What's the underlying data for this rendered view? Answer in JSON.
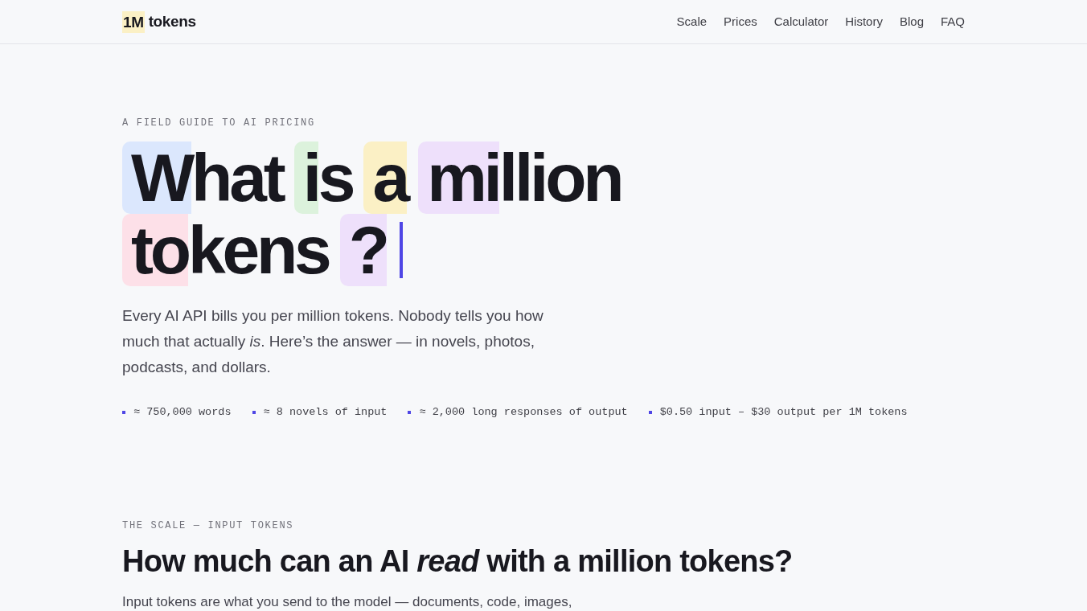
{
  "header": {
    "logo": {
      "mark": "1M",
      "text": "tokens"
    },
    "nav": [
      "Scale",
      "Prices",
      "Calculator",
      "History",
      "Blog",
      "FAQ"
    ]
  },
  "hero": {
    "eyebrow": "A FIELD GUIDE TO AI PRICING",
    "headline": [
      [
        {
          "highlighted": "W",
          "rest": "hat",
          "color": "#dbe7fd"
        },
        {
          "highlighted": "i",
          "rest": "s",
          "color": "#dcf2dc"
        },
        {
          "highlighted": "a",
          "color": "#fbf0c5"
        },
        {
          "highlighted": "mi",
          "rest": "llion",
          "color": "#eee0fb"
        }
      ],
      [
        {
          "highlighted": "to",
          "rest": "kens",
          "color": "#fde0e8"
        },
        {
          "highlighted": "?",
          "color": "#eee0fb"
        }
      ]
    ],
    "cursor": true,
    "intro": "Every AI API bills you per million tokens. Nobody tells you how much that actually *is*. Here’s the answer — in novels, photos, podcasts, and dollars.",
    "stats": [
      "≈ 750,000 words",
      "≈ 8 novels of input",
      "≈ 2,000 long responses of output",
      "$0.50 input – $30 output per 1M tokens"
    ]
  },
  "section": {
    "eyebrow": "THE SCALE — INPUT TOKENS",
    "title": "How much can an AI *read* with a million tokens?",
    "intro": "Input tokens are what you send to the model — documents, code, images,"
  }
}
